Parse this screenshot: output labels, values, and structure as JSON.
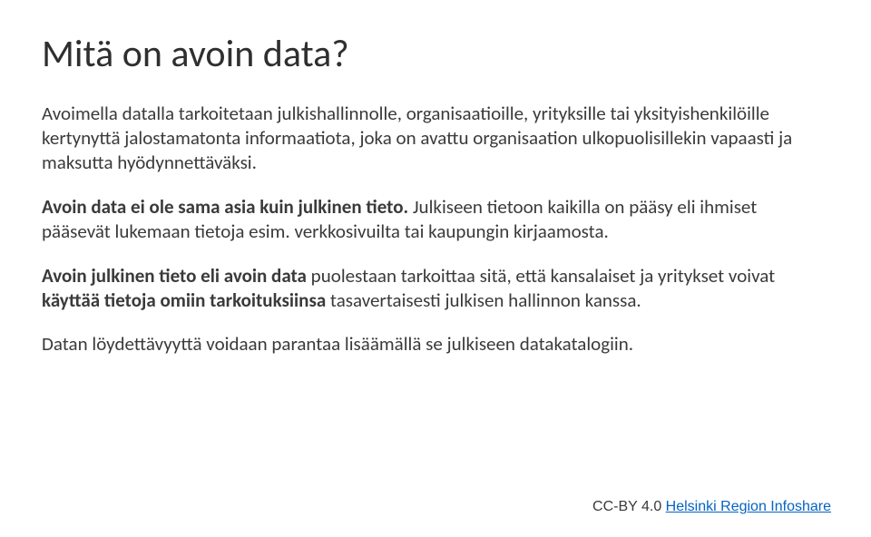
{
  "title": "Mitä on avoin data?",
  "p1": "Avoimella datalla tarkoitetaan julkishallinnolle, organisaatioille, yrityksille tai yksityishenkilöille kertynyttä jalostamatonta informaatiota, joka on avattu organisaation ulkopuolisillekin vapaasti ja maksutta hyödynnettäväksi.",
  "p2_bold": "Avoin data ei ole sama asia kuin julkinen tieto.",
  "p2_rest": " Julkiseen tietoon kaikilla on pääsy eli ihmiset pääsevät lukemaan tietoja esim. verkkosivuilta tai kaupungin kirjaamosta.",
  "p3_bold": "Avoin julkinen tieto eli avoin data",
  "p3_mid1": " puolestaan tarkoittaa sitä, että kansalaiset ja yritykset voivat ",
  "p3_bold2": "käyttää tietoja omiin tarkoituksiinsa",
  "p3_mid2": " tasavertaisesti julkisen hallinnon kanssa.",
  "p4": "Datan löydettävyyttä voidaan parantaa lisäämällä se julkiseen datakatalogiin.",
  "footer_prefix": "CC-BY 4.0 ",
  "footer_link": "Helsinki Region Infoshare"
}
